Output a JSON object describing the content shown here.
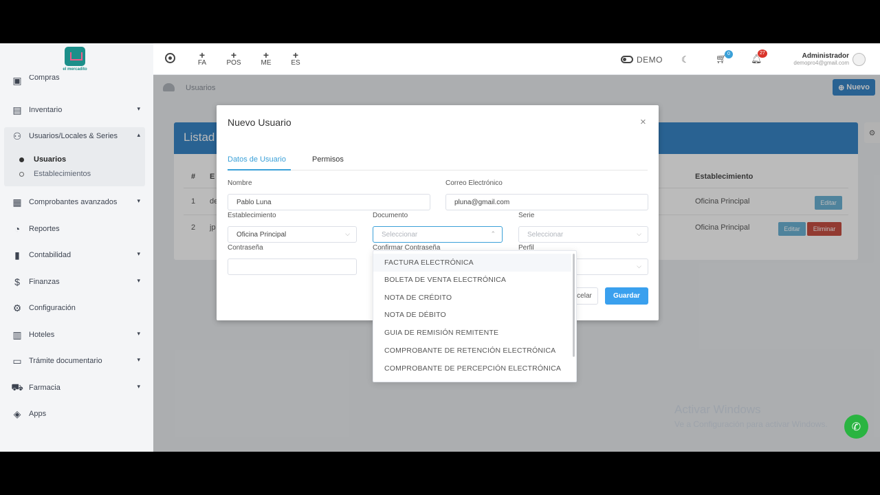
{
  "sidebar": {
    "logo_text": "el mercadito",
    "top_partial": "Compras",
    "items": [
      {
        "label": "Inventario",
        "icon": "inventory-icon"
      },
      {
        "label": "Usuarios/Locales & Series",
        "icon": "users-icon"
      },
      {
        "label": "Comprobantes avanzados",
        "icon": "receipt-icon"
      },
      {
        "label": "Reportes",
        "icon": "chart-pie-icon"
      },
      {
        "label": "Contabilidad",
        "icon": "bar-chart-icon"
      },
      {
        "label": "Finanzas",
        "icon": "dollar-icon"
      },
      {
        "label": "Configuración",
        "icon": "gear-icon"
      },
      {
        "label": "Hoteles",
        "icon": "building-icon"
      },
      {
        "label": "Trámite documentario",
        "icon": "folder-icon"
      },
      {
        "label": "Farmacia",
        "icon": "truck-icon"
      },
      {
        "label": "Apps",
        "icon": "cube-icon"
      }
    ],
    "sub_items": [
      {
        "label": "Usuarios",
        "active": true
      },
      {
        "label": "Establecimientos",
        "active": false
      }
    ]
  },
  "topbar": {
    "shortcuts": [
      "FA",
      "POS",
      "ME",
      "ES"
    ],
    "demo_label": "DEMO",
    "cart_badge": "0",
    "bell_badge": "27",
    "user_name": "Administrador",
    "user_email": "demopro4@gmail.com"
  },
  "content": {
    "breadcrumb": "Usuarios",
    "new_button": "Nuevo",
    "card_title": "Listad",
    "headers": {
      "num": "#",
      "email_partial": "E",
      "establishment": "Establecimiento"
    },
    "rows": [
      {
        "num": "1",
        "email_partial": "de",
        "establishment": "Oficina Principal",
        "edit": "Editar"
      },
      {
        "num": "2",
        "email_partial": "jp",
        "establishment": "Oficina Principal",
        "edit": "Editar",
        "delete": "Eliminar"
      }
    ]
  },
  "modal": {
    "title": "Nuevo Usuario",
    "close": "×",
    "tabs": [
      "Datos de Usuario",
      "Permisos"
    ],
    "fields": {
      "nombre_label": "Nombre",
      "nombre_value": "Pablo Luna",
      "correo_label": "Correo Electrónico",
      "correo_value": "pluna@gmail.com",
      "establecimiento_label": "Establecimiento",
      "establecimiento_value": "Oficina Principal",
      "documento_label": "Documento",
      "documento_placeholder": "Seleccionar",
      "serie_label": "Serie",
      "serie_placeholder": "Seleccionar",
      "contrasena_label": "Contraseña",
      "confirmar_label": "Confirmar Contraseña",
      "perfil_label": "Perfil"
    },
    "cancel_partial": "celar",
    "save": "Guardar"
  },
  "dropdown": {
    "options": [
      "FACTURA ELECTRÓNICA",
      "BOLETA DE VENTA ELECTRÓNICA",
      "NOTA DE CRÉDITO",
      "NOTA DE DÉBITO",
      "GUIA DE REMISIÓN REMITENTE",
      "COMPROBANTE DE RETENCIÓN ELECTRÓNICA",
      "COMPROBANTE DE PERCEPCIÓN ELECTRÓNICA"
    ]
  },
  "watermark": {
    "line1": "Activar Windows",
    "line2": "Ve a Configuración para activar Windows."
  },
  "colors": {
    "primary": "#1f77c0",
    "accent": "#3aa0d8",
    "danger": "#c0392b",
    "edit": "#5aa9cf",
    "whatsapp": "#2ab441"
  }
}
